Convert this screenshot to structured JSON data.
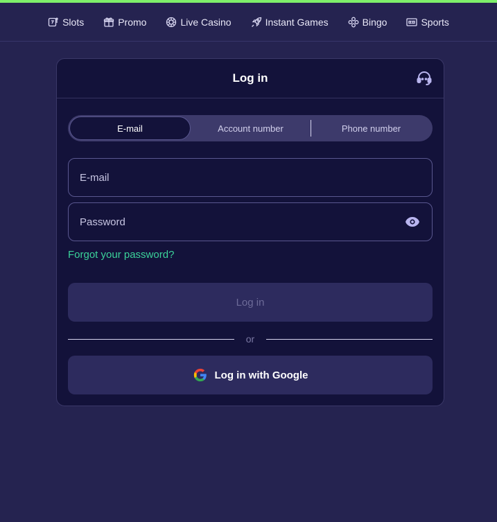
{
  "nav": {
    "items": [
      {
        "label": "Slots",
        "icon": "slot-machine-icon"
      },
      {
        "label": "Promo",
        "icon": "gift-icon"
      },
      {
        "label": "Live Casino",
        "icon": "roulette-icon"
      },
      {
        "label": "Instant Games",
        "icon": "rocket-icon"
      },
      {
        "label": "Bingo",
        "icon": "bingo-balls-icon"
      },
      {
        "label": "Sports",
        "icon": "scoreboard-icon"
      }
    ]
  },
  "login": {
    "title": "Log in",
    "support_icon": "headset-icon",
    "tabs": [
      {
        "label": "E-mail",
        "active": true
      },
      {
        "label": "Account number",
        "active": false
      },
      {
        "label": "Phone number",
        "active": false
      }
    ],
    "email": {
      "placeholder": "E-mail",
      "value": ""
    },
    "password": {
      "placeholder": "Password",
      "value": "",
      "toggle_icon": "eye-icon"
    },
    "forgot_label": "Forgot your password?",
    "submit_label": "Log in",
    "or_label": "or",
    "google_label": "Log in with Google",
    "google_icon": "google-icon"
  },
  "colors": {
    "background": "#252350",
    "card": "#13123a",
    "accent_bar": "#7ef06a",
    "link": "#3bd39a",
    "button": "#2d2b5e"
  }
}
